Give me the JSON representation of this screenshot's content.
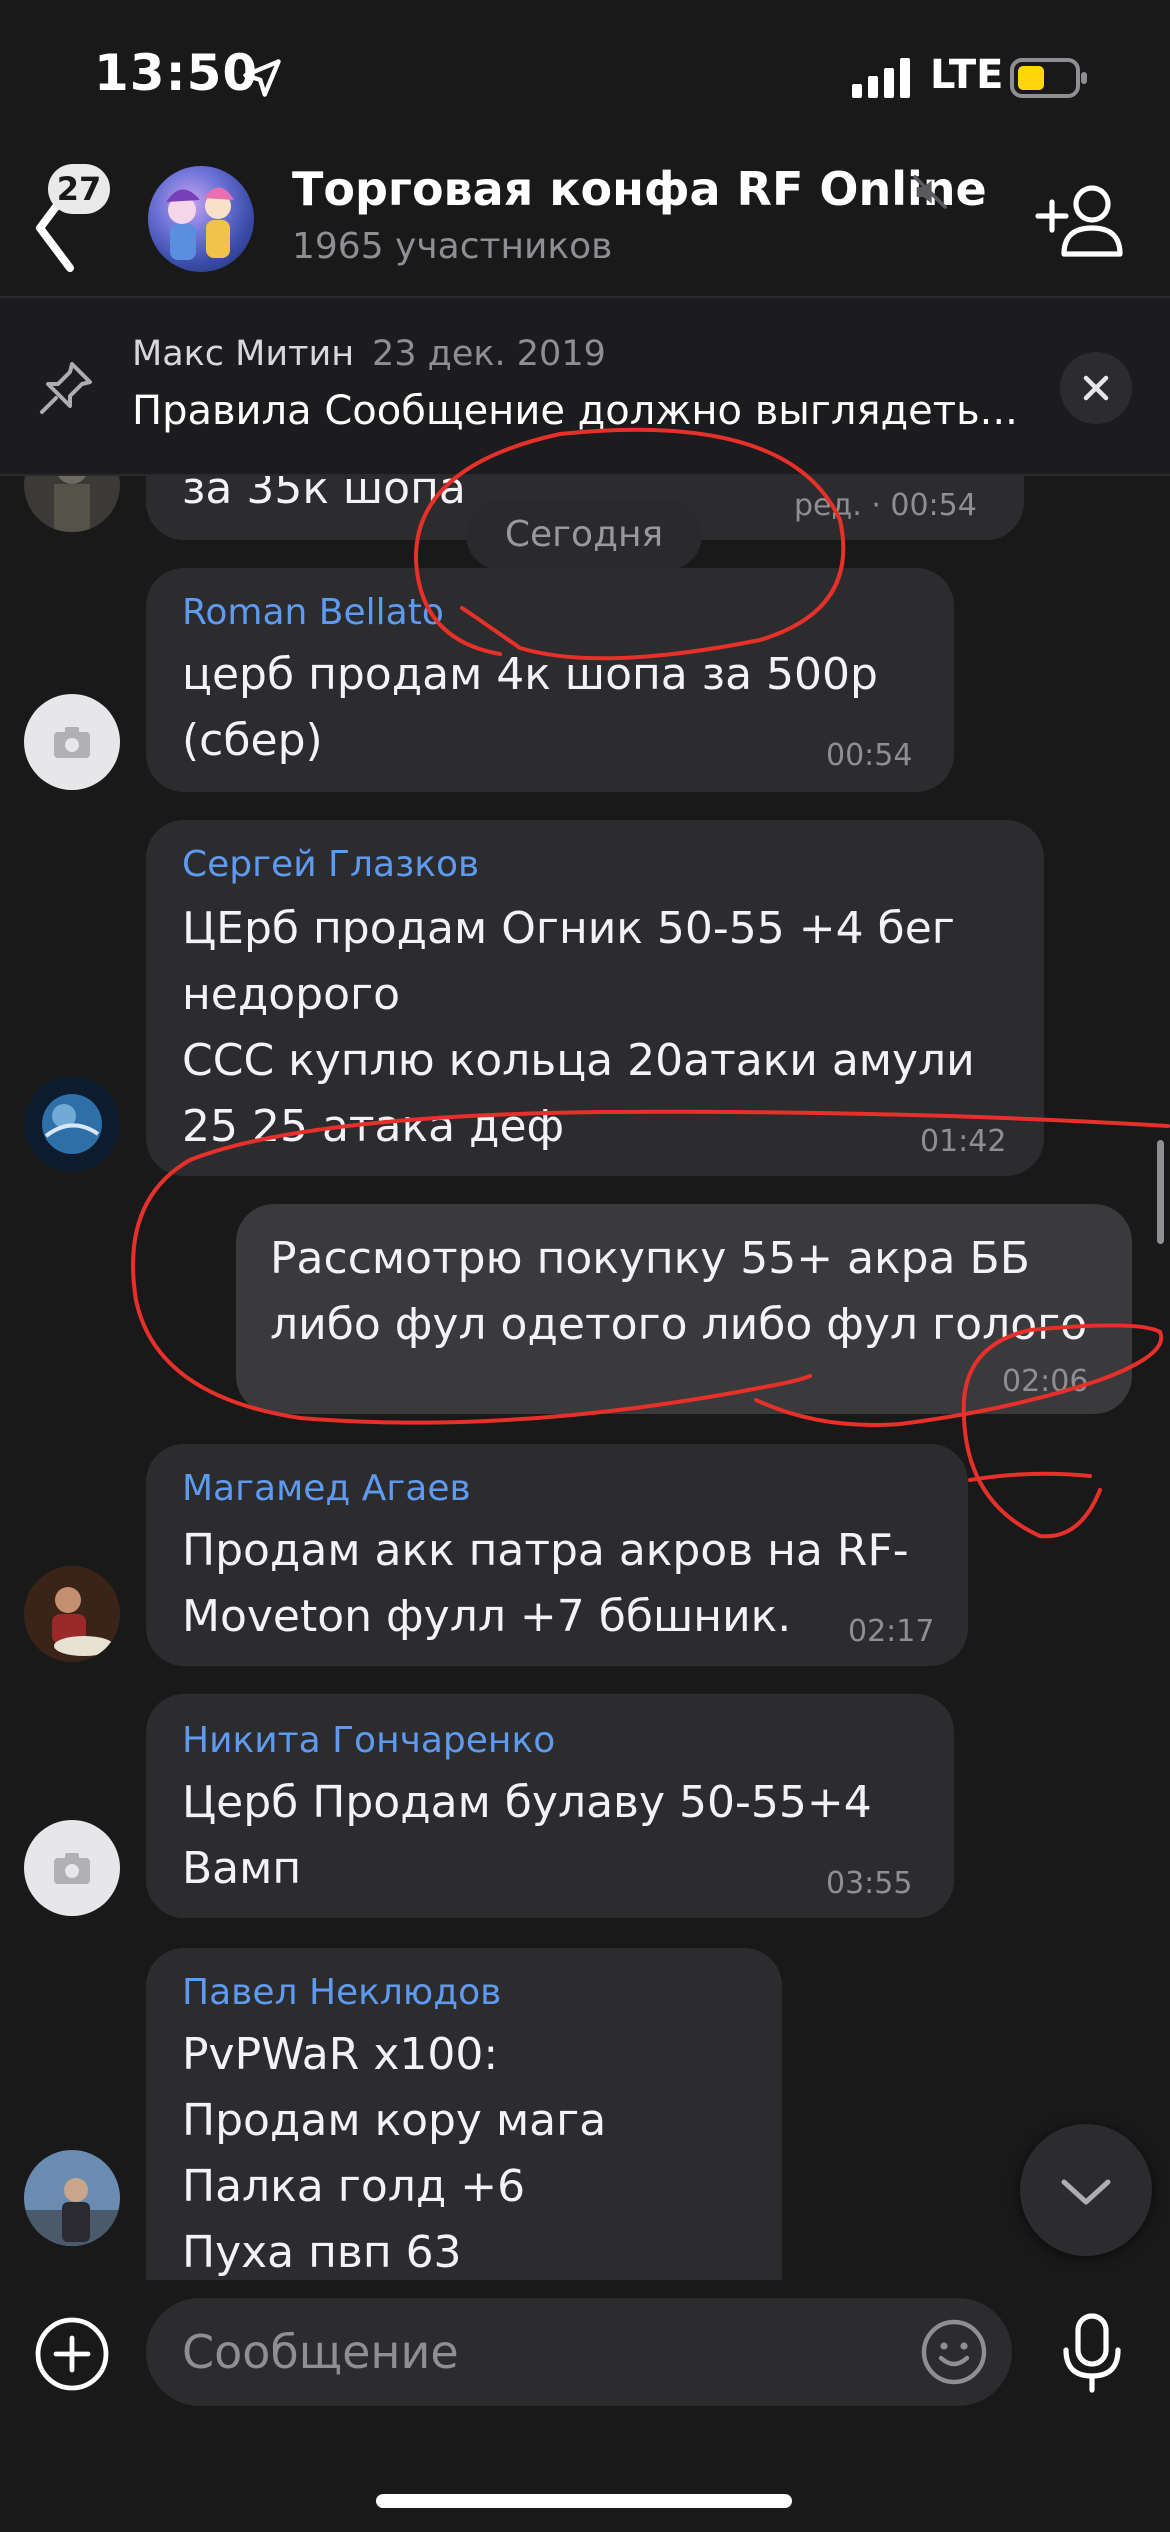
{
  "status_bar": {
    "time": "13:50",
    "network": "LTE"
  },
  "header": {
    "back_badge": "27",
    "title": "Торговая конфа RF Online",
    "subtitle": "1965 участников"
  },
  "pinned": {
    "author": "Макс Митин",
    "date": "23 дек. 2019",
    "text": "Правила Сообщение должно выглядеть..."
  },
  "date_separator": "Сегодня",
  "messages": [
    {
      "sender": "",
      "text": "за 35к шопа",
      "time": "ред. · 00:54"
    },
    {
      "sender": "Roman Bellato",
      "text": "церб продам 4к шопа за 500р\n(сбер)",
      "time": "00:54"
    },
    {
      "sender": "Сергей Глазков",
      "text": "ЦЕрб продам Огник 50-55 +4 бег\nнедорого\nССС куплю кольца 20атаки амули\n25 25 атака деф",
      "time": "01:42"
    },
    {
      "sender": "",
      "text": "Рассмотрю покупку 55+ акра ББ\nлибо фул одетого либо фул голого",
      "time": "02:06"
    },
    {
      "sender": "Магамед Агаев",
      "text": "Продам акк патра акров на RF-\nMoveton фулл +7 ббшник.",
      "time": "02:17"
    },
    {
      "sender": "Никита Гончаренко",
      "text": "Церб Продам булаву 50-55+4\nВамп",
      "time": "03:55"
    },
    {
      "sender": "Павел Неклюдов",
      "text": "PvPWaR x100:\nПродам кору мага\nПалка голд +6\nПуха пвп 63",
      "time": ""
    }
  ],
  "input": {
    "placeholder": "Сообщение"
  },
  "colors": {
    "background": "#19191a",
    "bubble": "#2c2c2e",
    "sender_name": "#5e9bf0",
    "annotation": "#e8302a",
    "battery": "#ffd60a"
  }
}
